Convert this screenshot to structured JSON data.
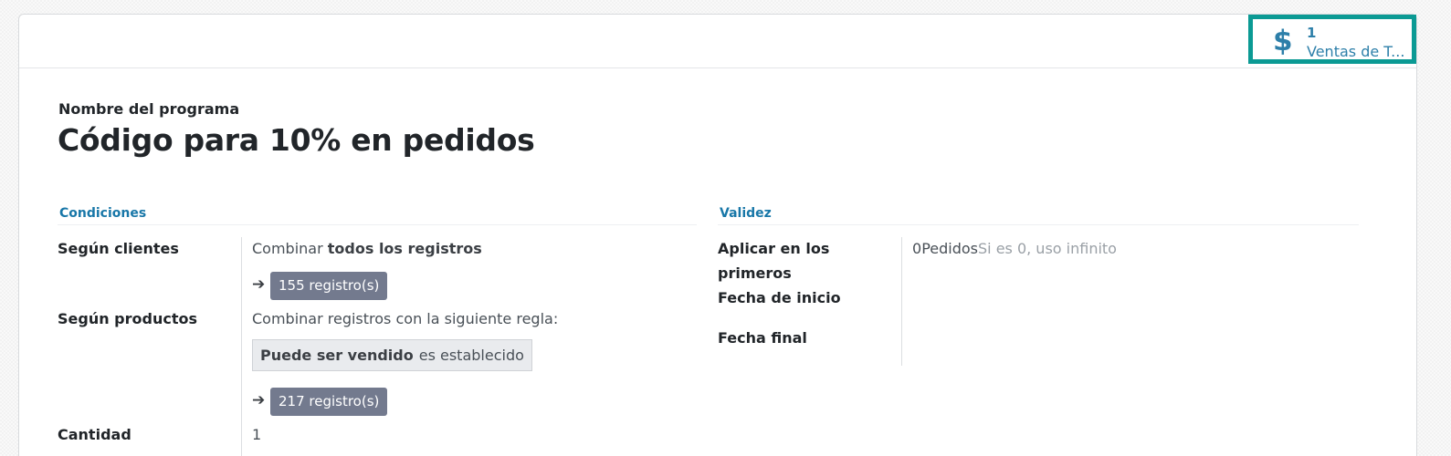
{
  "smart_button": {
    "icon": "dollar-icon",
    "value": "1",
    "label": "Ventas de T..."
  },
  "program": {
    "label": "Nombre del programa",
    "name": "Código para 10% en pedidos"
  },
  "conditions": {
    "title": "Condiciones",
    "customers": {
      "label": "Según clientes",
      "prefix": "Combinar ",
      "bold": "todos los registros",
      "records": "155 registro(s)"
    },
    "products": {
      "label": "Según productos",
      "text": "Combinar registros con la siguiente regla:",
      "rule_field": "Puede ser vendido",
      "rule_op": "es establecido",
      "records": "217 registro(s)"
    },
    "quantity": {
      "label": "Cantidad",
      "value": "1"
    }
  },
  "validity": {
    "title": "Validez",
    "apply_first": {
      "label_line1": "Aplicar en los",
      "label_line2": "primeros",
      "value": "0",
      "unit": "Pedidos",
      "hint": "Si es 0, uso infinito"
    },
    "start_date": {
      "label": "Fecha de inicio",
      "value": ""
    },
    "end_date": {
      "label": "Fecha final",
      "value": ""
    }
  },
  "colors": {
    "accent": "#1877a8",
    "smart_button_border": "#0b9a94",
    "badge": "#737a8e"
  }
}
